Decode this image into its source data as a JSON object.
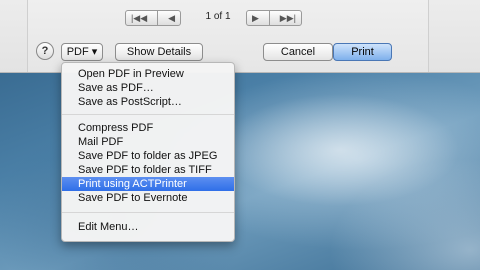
{
  "pager": {
    "first_glyph": "|◀◀",
    "prev_glyph": "◀",
    "next_glyph": "▶",
    "last_glyph": "▶▶|",
    "page_label": "1 of 1"
  },
  "toolbar": {
    "help_label": "?",
    "pdf_label": "PDF ▾",
    "details_label": "Show Details",
    "cancel_label": "Cancel",
    "print_label": "Print"
  },
  "pdf_menu": {
    "group1": [
      "Open PDF in Preview",
      "Save as PDF…",
      "Save as PostScript…"
    ],
    "group2": [
      "Compress PDF",
      "Mail PDF",
      "Save PDF to folder as JPEG",
      "Save PDF to folder as TIFF",
      "Print using ACTPrinter",
      "Save PDF to Evernote"
    ],
    "group3": [
      "Edit Menu…"
    ],
    "selected": "Print using ACTPrinter"
  },
  "colors": {
    "selection": "#3a77ea",
    "print_button": "#7fb0ec"
  }
}
